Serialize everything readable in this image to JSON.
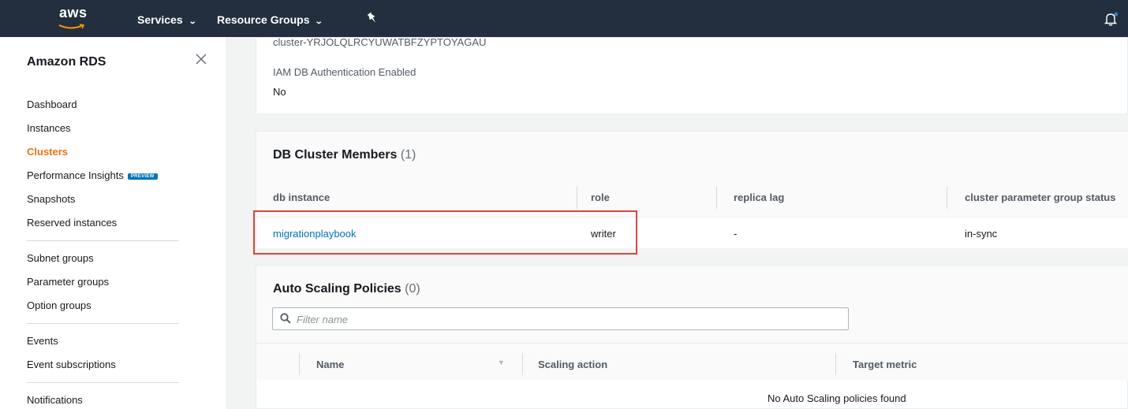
{
  "topnav": {
    "logo_text": "aws",
    "services_label": "Services",
    "resource_groups_label": "Resource Groups"
  },
  "sidebar": {
    "title": "Amazon RDS",
    "items": [
      {
        "label": "Dashboard"
      },
      {
        "label": "Instances"
      },
      {
        "label": "Clusters"
      },
      {
        "label": "Performance Insights",
        "badge": "PREVIEW"
      },
      {
        "label": "Snapshots"
      },
      {
        "label": "Reserved instances"
      },
      {
        "label": "Subnet groups"
      },
      {
        "label": "Parameter groups"
      },
      {
        "label": "Option groups"
      },
      {
        "label": "Events"
      },
      {
        "label": "Event subscriptions"
      },
      {
        "label": "Notifications"
      }
    ],
    "active_item": "Clusters"
  },
  "details": {
    "resource_id_value": "cluster-YRJOLQLRCYUWATBFZYPTOYAGAU",
    "iam_label": "IAM DB Authentication Enabled",
    "iam_value": "No"
  },
  "members": {
    "title": "DB Cluster Members",
    "count": "(1)",
    "columns": [
      "db instance",
      "role",
      "replica lag",
      "cluster parameter group status"
    ],
    "rows": [
      {
        "db_instance": "migrationplaybook",
        "role": "writer",
        "replica_lag": "-",
        "param_status": "in-sync"
      }
    ]
  },
  "autoscaling": {
    "title": "Auto Scaling Policies",
    "count": "(0)",
    "filter_placeholder": "Filter name",
    "columns": [
      "Name",
      "Scaling action",
      "Target metric"
    ],
    "empty_message": "No Auto Scaling policies found"
  },
  "colors": {
    "nav_bg": "#232f3e",
    "active": "#ec7211",
    "link": "#0073bb",
    "highlight": "#d9453b"
  }
}
